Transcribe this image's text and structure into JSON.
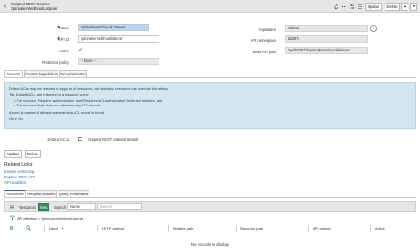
{
  "header": {
    "back_glyph": "‹",
    "type_label": "Scripted REST Service",
    "record_name": "SpinnakerWebhookListener",
    "icons": [
      "attachment-icon",
      "more-icon",
      "sliders-icon",
      "menu-icon"
    ],
    "update_label": "Update",
    "delete_label": "Delete",
    "nav_up": "▲",
    "nav_down": "▼"
  },
  "form": {
    "name_label": "Name",
    "name_value": "SpinnakerWebhookListener",
    "api_id_label": "API ID",
    "api_id_value": "spinnakerwebhooklistener",
    "active_label": "Active",
    "active_check": "✓",
    "protection_label": "Protection policy",
    "protection_value": "-- None --",
    "application_label": "Application",
    "application_value": "Global",
    "api_namespace_label": "API namespace",
    "api_namespace_value": "520971",
    "base_api_path_label": "Base API path",
    "base_api_path_value": "/api/520971/spinnakerwebhooklistener",
    "info_glyph": "i",
    "required_glyph": "✱"
  },
  "tabs": [
    {
      "label": "Security"
    },
    {
      "label": "Content Negotiation"
    },
    {
      "label": "Documentation"
    }
  ],
  "security_info": {
    "line1": "Default ACLs may be selected to apply to all resources, but individual resources can override this setting.",
    "line2": "The Default ACLs are enforced for a resource when:",
    "line3": "• The resource 'Requires authentication' and 'Requires ACL authorization' fields are selected, and",
    "line4": "• The resource itself does not reference any ACL records",
    "line5": "Access is granted if at least one matching ACL record is found.",
    "more_info": "More info"
  },
  "default_acls": {
    "label": "Default ACLs",
    "value": "Scripted REST External Default"
  },
  "bottom_buttons": {
    "update_label": "Update",
    "delete_label": "Delete"
  },
  "related_links": {
    "title": "Related Links",
    "links": [
      "Enable versioning",
      "Explore REST API",
      "API analytics"
    ]
  },
  "related_tabs": [
    {
      "label": "Resources"
    },
    {
      "label": "Request Headers"
    },
    {
      "label": "Query Parameters"
    }
  ],
  "list": {
    "title": "Resources",
    "new_label": "New",
    "search_label": "Search",
    "search_field": "Name",
    "search_placeholder": "Search",
    "breadcrumb": "API definition = SpinnakerWebhookListener",
    "columns": [
      "Name",
      "HTTP method",
      "Relative path",
      "Resource path",
      "API version",
      "Active"
    ],
    "sort_glyph": "▲",
    "empty_message": "No records to display"
  },
  "colors": {
    "accent": "#2c6f9c",
    "new_button": "#3b8b5c",
    "info_bg": "#d4e7ee",
    "header_bg": "#e4e6e7"
  }
}
